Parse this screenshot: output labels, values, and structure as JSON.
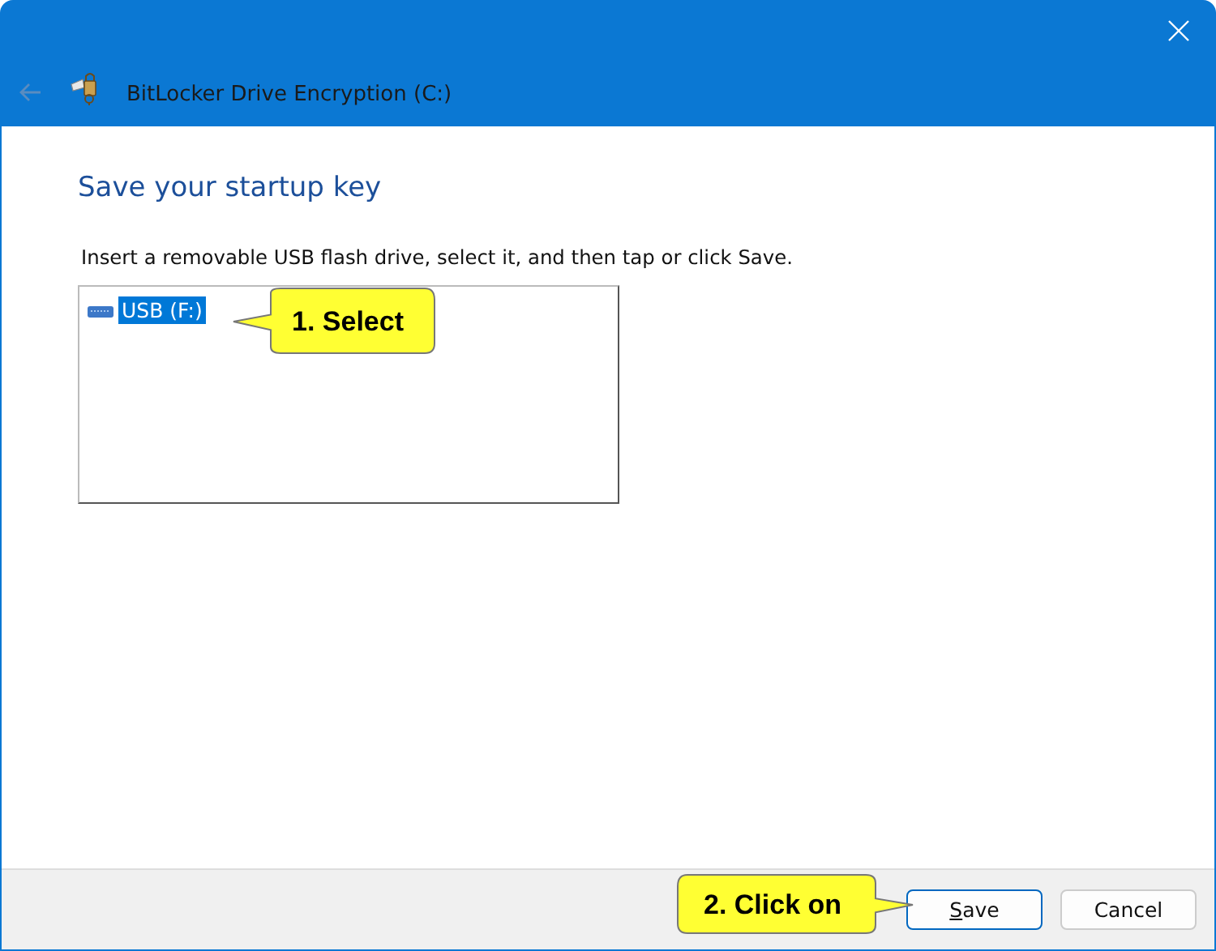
{
  "window": {
    "title": "BitLocker Drive Encryption (C:)"
  },
  "heading": "Save your startup key",
  "instruction": "Insert a removable USB flash drive, select it, and then tap or click Save.",
  "drives": [
    {
      "label": "USB (F:)",
      "selected": true
    }
  ],
  "callouts": [
    {
      "text": "1. Select",
      "kind": "left"
    },
    {
      "text": "2. Click on",
      "kind": "right"
    }
  ],
  "buttons": [
    {
      "label": "Save",
      "default": true
    },
    {
      "label": "Cancel",
      "default": false
    }
  ]
}
